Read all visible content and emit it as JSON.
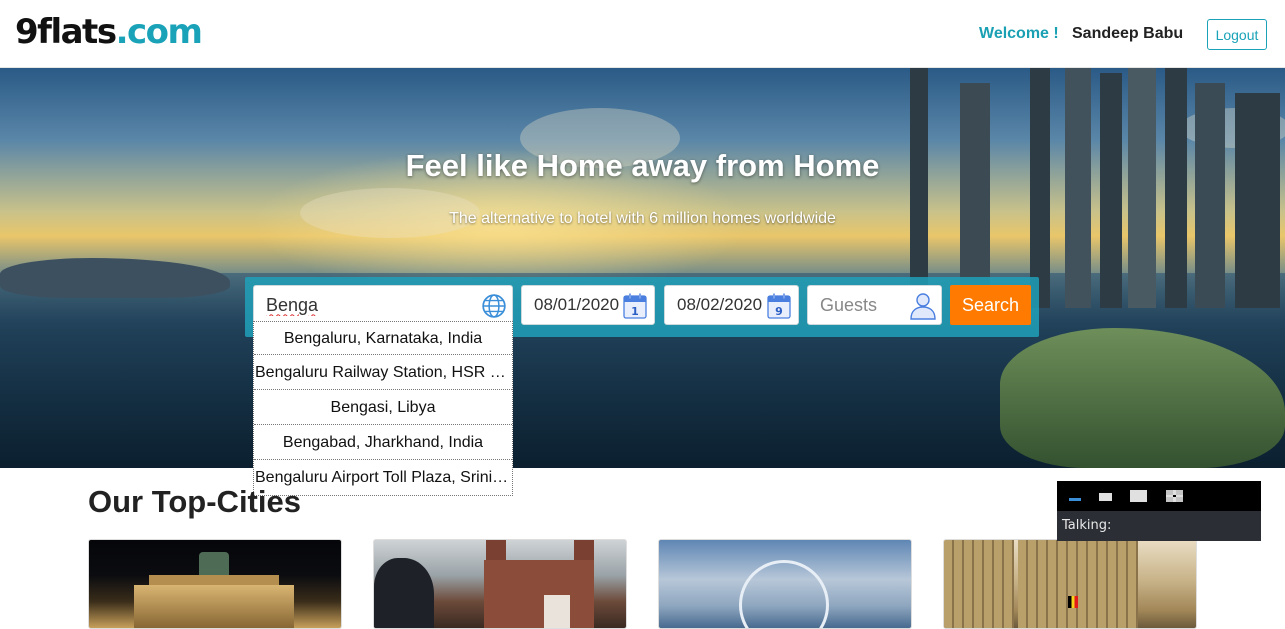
{
  "header": {
    "logo": {
      "nine": "9",
      "flats": "flats",
      "dotcom": ".com"
    },
    "welcome": "Welcome !",
    "username": "Sandeep Babu",
    "logout_label": "Logout"
  },
  "hero": {
    "title": "Feel like Home away from Home",
    "subtitle": "The alternative to hotel with 6 million homes worldwide"
  },
  "search": {
    "location_value": "Benga",
    "checkin_value": "08/01/2020",
    "checkout_value": "08/02/2020",
    "checkin_day": "1",
    "checkout_day": "9",
    "guests_placeholder": "Guests",
    "search_label": "Search",
    "suggestions": [
      "Bengaluru, Karnataka, India",
      "Bengaluru Railway Station, HSR Layout, Bengaluru",
      "Bengasi, Libya",
      "Bengabad, Jharkhand, India",
      "Bengaluru Airport Toll Plaza, Srinivasapura"
    ]
  },
  "top_cities": {
    "title": "Our Top-Cities"
  },
  "talk_widget": {
    "label": "Talking:"
  },
  "colors": {
    "accent": "#1aa3b8",
    "search_button": "#ff7a00"
  }
}
